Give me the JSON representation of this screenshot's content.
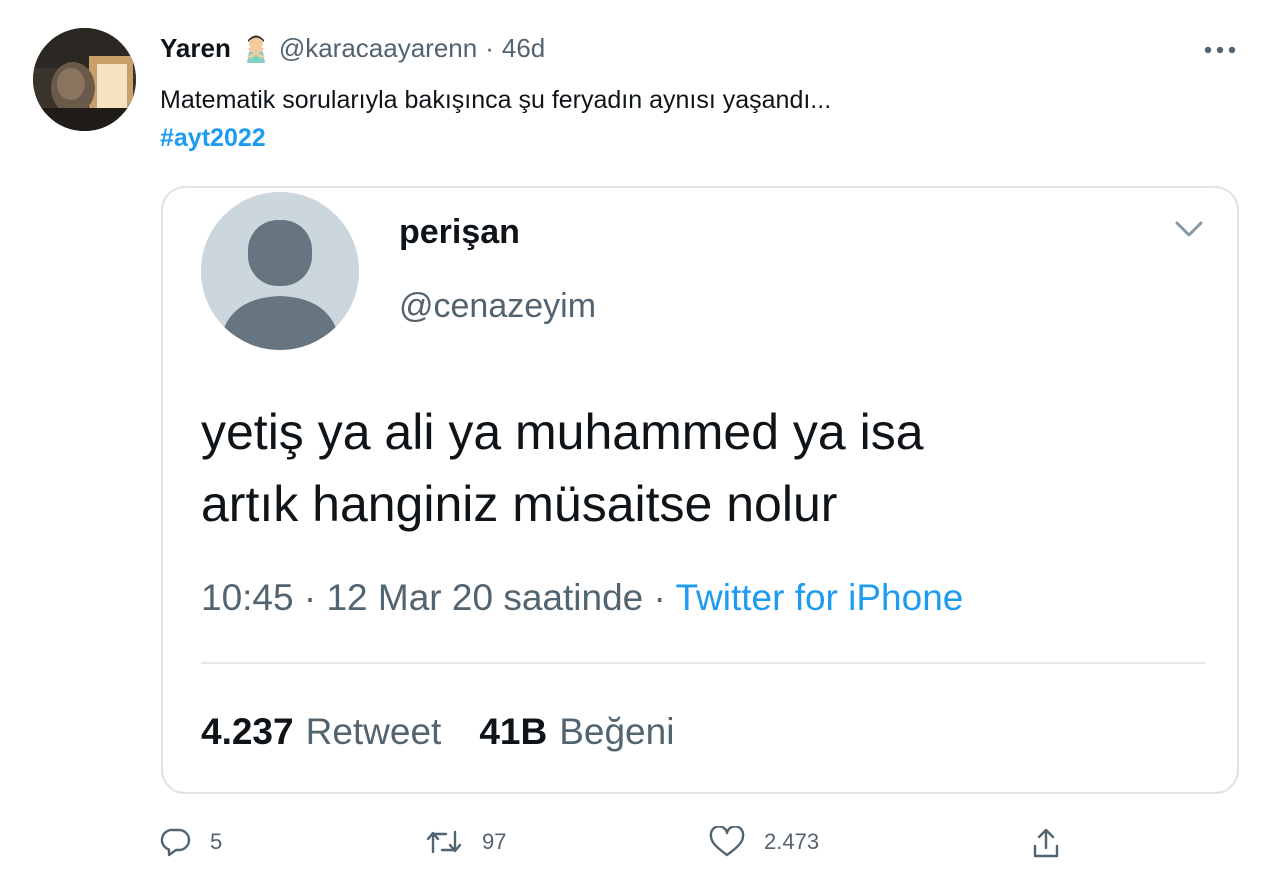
{
  "tweet": {
    "display_name": "Yaren",
    "emoji": "person-gesturing-no-emoji",
    "handle": "@karacaayarenn",
    "separator": "·",
    "time": "46d",
    "text": "Matematik sorularıyla bakışınca şu feryadın aynısı yaşandı...",
    "hashtag": "#ayt2022"
  },
  "quote": {
    "name": "perişan",
    "handle": "@cenazeyim",
    "line1": "yetiş ya ali ya muhammed ya isa",
    "line2": "artık hanginiz müsaitse nolur",
    "timestamp": "10:45 · 12 Mar 20 saatinde",
    "meta_separator": " · ",
    "source": "Twitter for iPhone",
    "retweet_count": "4.237",
    "retweet_label": "Retweet",
    "like_count": "41B",
    "like_label": "Beğeni"
  },
  "actions": {
    "reply_count": "5",
    "retweet_count": "97",
    "like_count": "2.473"
  },
  "icons": {
    "more": "more-horizontal-icon",
    "chevron": "chevron-down-icon",
    "reply": "reply-icon",
    "retweet": "retweet-icon",
    "like": "heart-icon",
    "share": "share-icon"
  },
  "colors": {
    "accent": "#1d9bf0",
    "text": "#0f1419",
    "secondary": "#536471",
    "border": "#dfe3e7"
  }
}
